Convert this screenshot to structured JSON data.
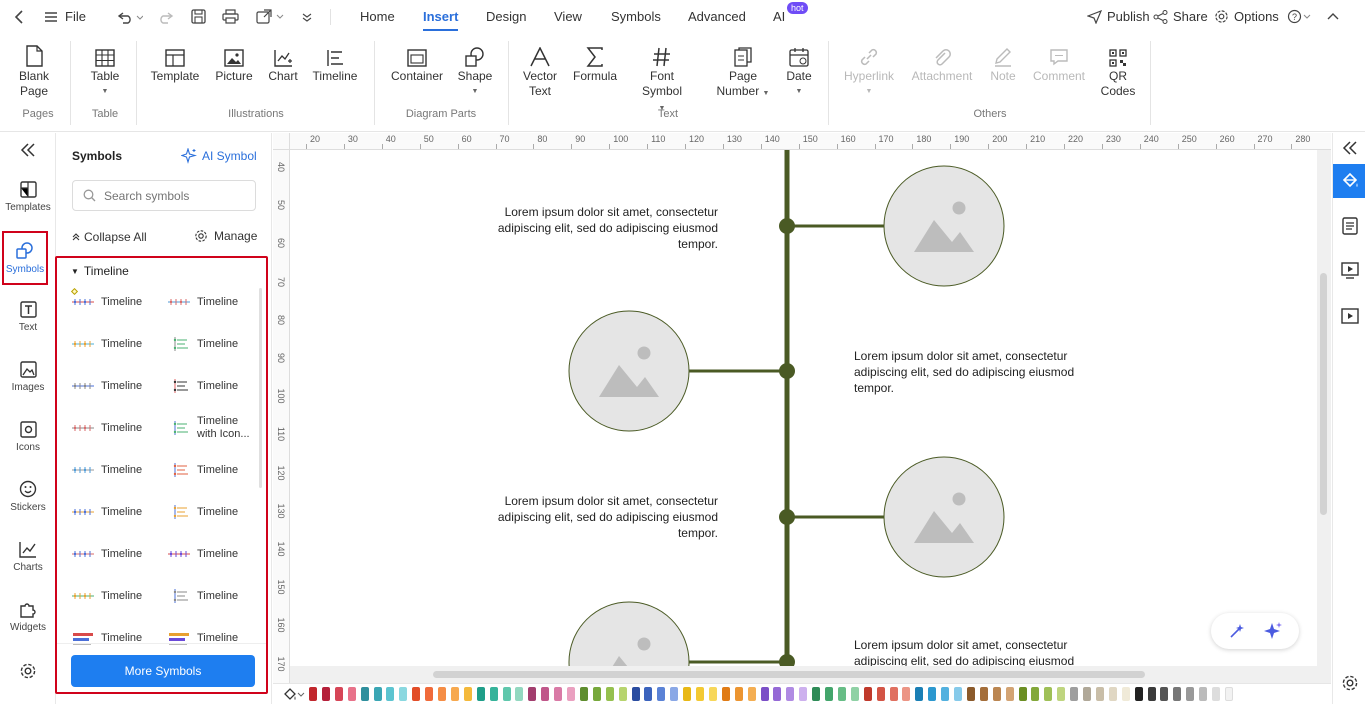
{
  "topbar": {
    "file_label": "File",
    "menu_tabs": [
      "Home",
      "Insert",
      "Design",
      "View",
      "Symbols",
      "Advanced",
      "AI"
    ],
    "active_tab": "Insert",
    "ai_badge": "hot",
    "publish_label": "Publish",
    "share_label": "Share",
    "options_label": "Options"
  },
  "ribbon": {
    "blank_page": "Blank",
    "blank_page2": "Page",
    "table": "Table",
    "template": "Template",
    "picture": "Picture",
    "chart": "Chart",
    "timeline": "Timeline",
    "container": "Container",
    "shape": "Shape",
    "vector_text": "Vector",
    "vector_text2": "Text",
    "formula": "Formula",
    "font_symbol": "Font",
    "font_symbol2": "Symbol",
    "page_number": "Page",
    "page_number2": "Number",
    "date": "Date",
    "hyperlink": "Hyperlink",
    "attachment": "Attachment",
    "note": "Note",
    "comment": "Comment",
    "qr_codes": "QR",
    "qr_codes2": "Codes",
    "groups": {
      "pages": "Pages",
      "table": "Table",
      "illustrations": "Illustrations",
      "diagram_parts": "Diagram Parts",
      "text": "Text",
      "others": "Others"
    }
  },
  "rail": [
    "Templates",
    "Symbols",
    "Text",
    "Images",
    "Icons",
    "Stickers",
    "Charts",
    "Widgets"
  ],
  "panel": {
    "title": "Symbols",
    "ai_symbol": "AI Symbol",
    "search_placeholder": "Search symbols",
    "collapse_all": "Collapse All",
    "manage": "Manage",
    "category": "Timeline",
    "items": [
      "Timeline",
      "Timeline",
      "Timeline",
      "Timeline",
      "Timeline",
      "Timeline",
      "Timeline",
      "Timeline with Icon...",
      "Timeline",
      "Timeline",
      "Timeline",
      "Timeline",
      "Timeline",
      "Timeline",
      "Timeline",
      "Timeline",
      "Timeline",
      "Timeline"
    ],
    "more_symbols": "More Symbols"
  },
  "ruler": {
    "h": [
      "20",
      "30",
      "40",
      "50",
      "60",
      "70",
      "80",
      "90",
      "100",
      "110",
      "120",
      "130",
      "140",
      "150",
      "160",
      "170",
      "180",
      "190",
      "200",
      "210",
      "220",
      "230",
      "240",
      "250",
      "260",
      "270",
      "280"
    ],
    "v": [
      "40",
      "50",
      "60",
      "70",
      "80",
      "90",
      "100",
      "110",
      "120",
      "130",
      "140",
      "150",
      "160",
      "170"
    ]
  },
  "canvas": {
    "lorem": [
      "Lorem ipsum dolor sit amet, consectetur adipiscing elit, sed do adipiscing eiusmod tempor.",
      "Lorem ipsum dolor sit amet, consectetur adipiscing elit, sed do adipiscing eiusmod tempor.",
      "Lorem ipsum dolor sit amet, consectetur adipiscing elit, sed do adipiscing eiusmod tempor.",
      "Lorem ipsum dolor sit amet, consectetur adipiscing elit, sed do adipiscing eiusmod"
    ],
    "line_color": "#4a5a24"
  },
  "colors": {
    "accent": "#2a6fdb",
    "highlight": "#d0021b",
    "palette": [
      "#c1272d",
      "#b5203a",
      "#d64557",
      "#e8728a",
      "#2f8f9d",
      "#3aa6b4",
      "#5cc4d0",
      "#8ad8e0",
      "#e24d28",
      "#f06a3a",
      "#f58d45",
      "#f7a94f",
      "#f4b93b",
      "#1f9e89",
      "#36b39a",
      "#5fc7ac",
      "#93d8c0",
      "#a23e6e",
      "#c0578a",
      "#d97aa6",
      "#eaa0c0",
      "#5e8d2e",
      "#77a83b",
      "#95c04e",
      "#b7d46e",
      "#2a4ca0",
      "#3b63bd",
      "#5a82d6",
      "#8aa8e6",
      "#e8b815",
      "#f3c933",
      "#f7d75a",
      "#e07b15",
      "#ec9531",
      "#f4ae52",
      "#7b4fc7",
      "#9569d6",
      "#b08be3",
      "#cdb0ee",
      "#2e8b57",
      "#43a56b",
      "#67bd86",
      "#8fd1a5",
      "#c0392b",
      "#d35445",
      "#e07060",
      "#ec9585",
      "#1a7fb5",
      "#2c98cf",
      "#53b1df",
      "#86caea",
      "#8b5a2b",
      "#a46e3a",
      "#bb8651",
      "#d3a474",
      "#6b8e23",
      "#83a83a",
      "#9fc057",
      "#bfd57f",
      "#9e9e9e",
      "#b0a898",
      "#c9bea8",
      "#e0d7c3",
      "#f0ead8",
      "#222222",
      "#3b3b3b",
      "#555555",
      "#777777",
      "#999999",
      "#bbbbbb",
      "#dddddd",
      "#f2f2f2"
    ]
  }
}
